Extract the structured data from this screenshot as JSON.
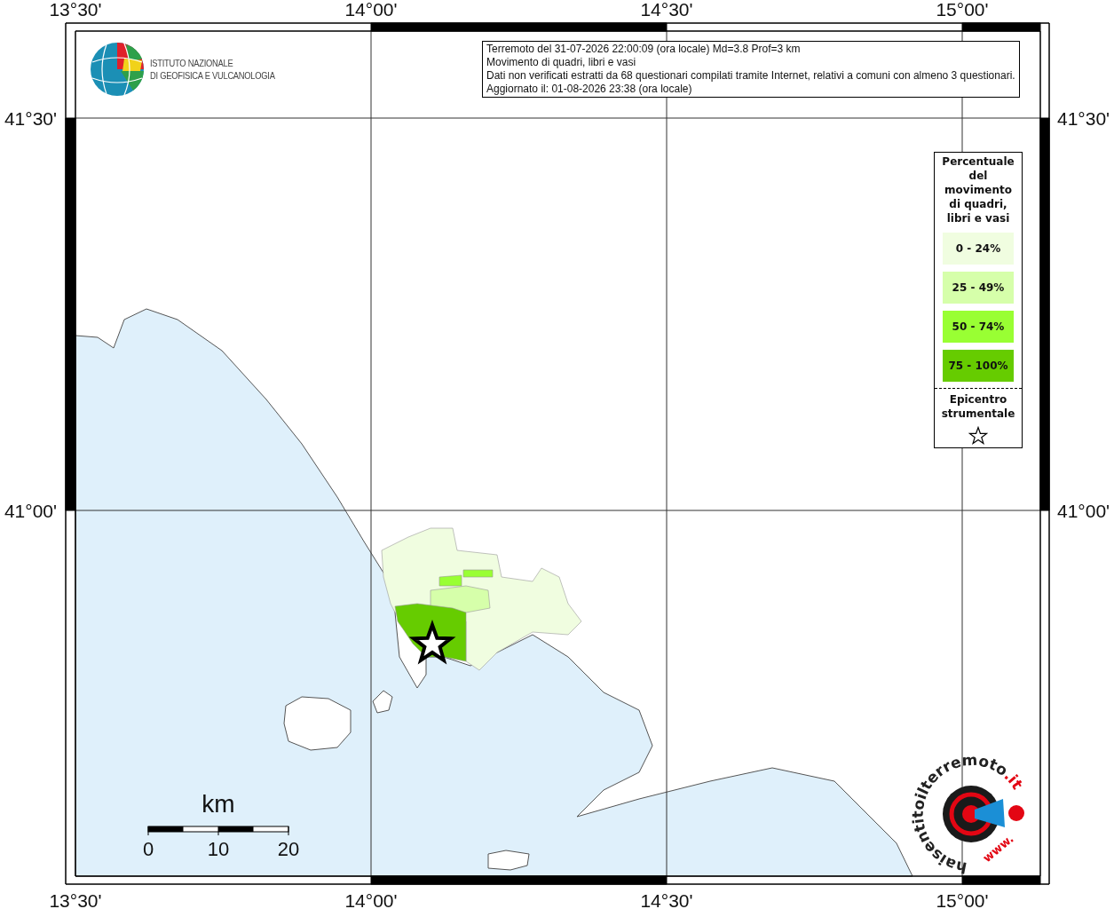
{
  "axis_labels": {
    "top": [
      "13°30'",
      "14°00'",
      "14°30'",
      "15°00'"
    ],
    "bottom": [
      "13°30'",
      "14°00'",
      "14°30'",
      "15°00'"
    ],
    "left": [
      "41°30'",
      "41°00'"
    ],
    "right": [
      "41°30'",
      "41°00'"
    ]
  },
  "institute_logo": {
    "lines": [
      "ISTITUTO NAZIONALE",
      "DI GEOFISICA E VULCANOLOGIA"
    ]
  },
  "info_box": {
    "lines": [
      "Terremoto del 31-07-2026 22:00:09 (ora locale) Md=3.8 Prof=3 km",
      "Movimento di quadri, libri e vasi",
      "Dati non verificati estratti da 68 questionari compilati tramite Internet, relativi a comuni con almeno 3 questionari.",
      "Aggiornato il: 01-08-2026 23:38 (ora locale)"
    ]
  },
  "legend": {
    "title": "Percentuale del movimento di quadri, libri e vasi",
    "classes": [
      {
        "label": "0 - 24%",
        "color": "#f0fde0"
      },
      {
        "label": "25 - 49%",
        "color": "#d6ffaa"
      },
      {
        "label": "50 - 74%",
        "color": "#99ff33"
      },
      {
        "label": "75 - 100%",
        "color": "#66cc00"
      }
    ],
    "epicenter_label": "Epicentro strumentale"
  },
  "shaded_areas": [
    {
      "color": "#f0fde0"
    },
    {
      "color": "#d6ffaa"
    },
    {
      "color": "#99ff33"
    },
    {
      "color": "#99ff33"
    },
    {
      "color": "#66cc00"
    }
  ],
  "scale_bar": {
    "unit": "km",
    "ticks": [
      "0",
      "10",
      "20"
    ]
  },
  "site_logo": {
    "prefix": "www.",
    "name": "haisentitoilterremoto",
    "suffix": ".it"
  }
}
